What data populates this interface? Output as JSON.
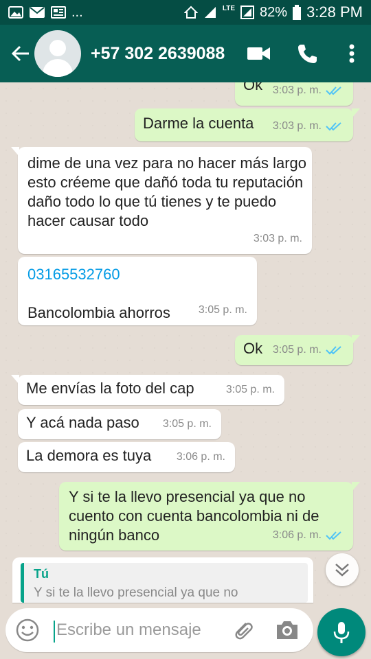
{
  "status_bar": {
    "left_icons": [
      "image-icon",
      "mail-icon",
      "news-icon"
    ],
    "more": "...",
    "battery": "82%",
    "time": "3:28 PM",
    "network": "LTE"
  },
  "header": {
    "contact": "+57 302 2639088",
    "icons": [
      "back-arrow-icon",
      "avatar",
      "video-call-icon",
      "phone-icon",
      "more-vert-icon"
    ]
  },
  "messages": [
    {
      "dir": "out",
      "text": "Ok",
      "time": "3:03 p. m.",
      "read": true
    },
    {
      "dir": "out",
      "text": "Darme la cuenta",
      "time": "3:03 p. m.",
      "read": true
    },
    {
      "dir": "in",
      "text": "dime de una vez para no hacer más largo esto créeme que dañó toda tu reputación daño todo lo que tú tienes y te puedo hacer causar todo",
      "time": "3:03 p. m."
    },
    {
      "dir": "in",
      "link": "03165532760",
      "text": "Bancolombia ahorros",
      "time": "3:05 p. m."
    },
    {
      "dir": "out",
      "text": "Ok",
      "time": "3:05 p. m.",
      "read": true
    },
    {
      "dir": "in",
      "text": "Me envías la foto del cap",
      "time": "3:05 p. m."
    },
    {
      "dir": "in",
      "text": "Y acá nada paso",
      "time": "3:05 p. m."
    },
    {
      "dir": "in",
      "text": "La demora es tuya",
      "time": "3:06 p. m."
    },
    {
      "dir": "out",
      "text": "Y si te la llevo presencial ya que no cuento con cuenta bancolombia ni de ningún banco",
      "time": "3:06 p. m.",
      "read": true
    }
  ],
  "reply_preview": {
    "author": "Tú",
    "text": "Y si te la llevo presencial ya que no"
  },
  "composer": {
    "placeholder": "Escribe un mensaje"
  },
  "colors": {
    "header": "#075e54",
    "status_bar": "#054d44",
    "out_bubble": "#dcf8c6",
    "in_bubble": "#ffffff",
    "accent": "#00897b",
    "read_ticks": "#4fc3f7",
    "link": "#039be5"
  }
}
